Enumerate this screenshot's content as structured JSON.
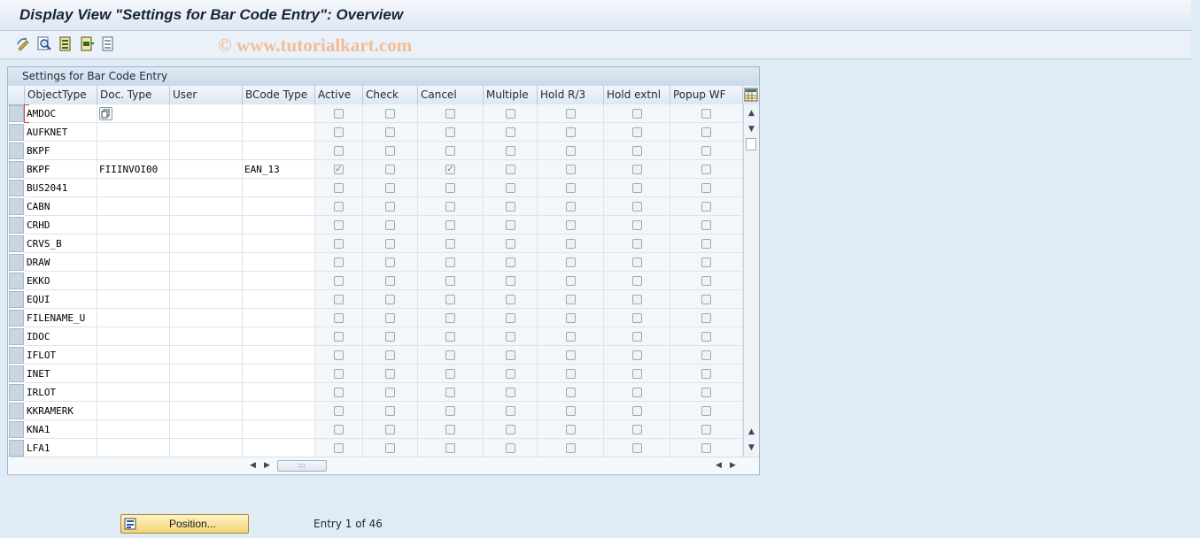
{
  "window": {
    "title": "Display View \"Settings for Bar Code Entry\": Overview"
  },
  "watermark": "© www.tutorialkart.com",
  "toolbar": {
    "icons": [
      "change-display-icon",
      "find-icon",
      "select-all-icon",
      "select-block-icon",
      "deselect-all-icon"
    ]
  },
  "table": {
    "title": "Settings for Bar Code Entry",
    "columns": [
      "ObjectType",
      "Doc. Type",
      "User",
      "BCode Type",
      "Active",
      "Check",
      "Cancel",
      "Multiple",
      "Hold R/3",
      "Hold extnl",
      "Popup WF"
    ],
    "rows": [
      {
        "object_type": "AMDOC",
        "doc_type": "",
        "user": "",
        "bcode_type": "",
        "active": false,
        "check": false,
        "cancel": false,
        "multiple": false,
        "hold_r3": false,
        "hold_extnl": false,
        "popup_wf": false
      },
      {
        "object_type": "AUFKNET",
        "doc_type": "",
        "user": "",
        "bcode_type": "",
        "active": false,
        "check": false,
        "cancel": false,
        "multiple": false,
        "hold_r3": false,
        "hold_extnl": false,
        "popup_wf": false
      },
      {
        "object_type": "BKPF",
        "doc_type": "",
        "user": "",
        "bcode_type": "",
        "active": false,
        "check": false,
        "cancel": false,
        "multiple": false,
        "hold_r3": false,
        "hold_extnl": false,
        "popup_wf": false
      },
      {
        "object_type": "BKPF",
        "doc_type": "FIIINVOI00",
        "user": "",
        "bcode_type": "EAN_13",
        "active": true,
        "check": false,
        "cancel": true,
        "multiple": false,
        "hold_r3": false,
        "hold_extnl": false,
        "popup_wf": false
      },
      {
        "object_type": "BUS2041",
        "doc_type": "",
        "user": "",
        "bcode_type": "",
        "active": false,
        "check": false,
        "cancel": false,
        "multiple": false,
        "hold_r3": false,
        "hold_extnl": false,
        "popup_wf": false
      },
      {
        "object_type": "CABN",
        "doc_type": "",
        "user": "",
        "bcode_type": "",
        "active": false,
        "check": false,
        "cancel": false,
        "multiple": false,
        "hold_r3": false,
        "hold_extnl": false,
        "popup_wf": false
      },
      {
        "object_type": "CRHD",
        "doc_type": "",
        "user": "",
        "bcode_type": "",
        "active": false,
        "check": false,
        "cancel": false,
        "multiple": false,
        "hold_r3": false,
        "hold_extnl": false,
        "popup_wf": false
      },
      {
        "object_type": "CRVS_B",
        "doc_type": "",
        "user": "",
        "bcode_type": "",
        "active": false,
        "check": false,
        "cancel": false,
        "multiple": false,
        "hold_r3": false,
        "hold_extnl": false,
        "popup_wf": false
      },
      {
        "object_type": "DRAW",
        "doc_type": "",
        "user": "",
        "bcode_type": "",
        "active": false,
        "check": false,
        "cancel": false,
        "multiple": false,
        "hold_r3": false,
        "hold_extnl": false,
        "popup_wf": false
      },
      {
        "object_type": "EKKO",
        "doc_type": "",
        "user": "",
        "bcode_type": "",
        "active": false,
        "check": false,
        "cancel": false,
        "multiple": false,
        "hold_r3": false,
        "hold_extnl": false,
        "popup_wf": false
      },
      {
        "object_type": "EQUI",
        "doc_type": "",
        "user": "",
        "bcode_type": "",
        "active": false,
        "check": false,
        "cancel": false,
        "multiple": false,
        "hold_r3": false,
        "hold_extnl": false,
        "popup_wf": false
      },
      {
        "object_type": "FILENAME_U",
        "doc_type": "",
        "user": "",
        "bcode_type": "",
        "active": false,
        "check": false,
        "cancel": false,
        "multiple": false,
        "hold_r3": false,
        "hold_extnl": false,
        "popup_wf": false
      },
      {
        "object_type": "IDOC",
        "doc_type": "",
        "user": "",
        "bcode_type": "",
        "active": false,
        "check": false,
        "cancel": false,
        "multiple": false,
        "hold_r3": false,
        "hold_extnl": false,
        "popup_wf": false
      },
      {
        "object_type": "IFLOT",
        "doc_type": "",
        "user": "",
        "bcode_type": "",
        "active": false,
        "check": false,
        "cancel": false,
        "multiple": false,
        "hold_r3": false,
        "hold_extnl": false,
        "popup_wf": false
      },
      {
        "object_type": "INET",
        "doc_type": "",
        "user": "",
        "bcode_type": "",
        "active": false,
        "check": false,
        "cancel": false,
        "multiple": false,
        "hold_r3": false,
        "hold_extnl": false,
        "popup_wf": false
      },
      {
        "object_type": "IRLOT",
        "doc_type": "",
        "user": "",
        "bcode_type": "",
        "active": false,
        "check": false,
        "cancel": false,
        "multiple": false,
        "hold_r3": false,
        "hold_extnl": false,
        "popup_wf": false
      },
      {
        "object_type": "KKRAMERK",
        "doc_type": "",
        "user": "",
        "bcode_type": "",
        "active": false,
        "check": false,
        "cancel": false,
        "multiple": false,
        "hold_r3": false,
        "hold_extnl": false,
        "popup_wf": false
      },
      {
        "object_type": "KNA1",
        "doc_type": "",
        "user": "",
        "bcode_type": "",
        "active": false,
        "check": false,
        "cancel": false,
        "multiple": false,
        "hold_r3": false,
        "hold_extnl": false,
        "popup_wf": false
      },
      {
        "object_type": "LFA1",
        "doc_type": "",
        "user": "",
        "bcode_type": "",
        "active": false,
        "check": false,
        "cancel": false,
        "multiple": false,
        "hold_r3": false,
        "hold_extnl": false,
        "popup_wf": false
      }
    ]
  },
  "footer": {
    "position_button": "Position...",
    "entry_info": "Entry 1 of 46"
  },
  "colors": {
    "accent_button": "#f1d474",
    "background": "#dfebf5",
    "header": "#dde7f1"
  }
}
